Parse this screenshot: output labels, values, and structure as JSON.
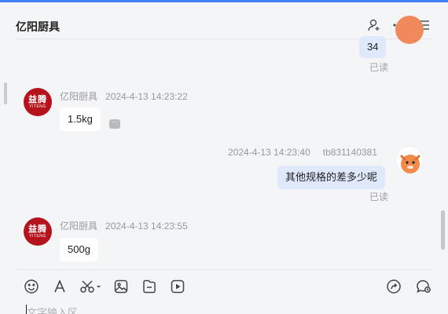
{
  "window": {
    "accent": "#3f7ff3"
  },
  "header": {
    "title": "亿阳厨具",
    "icons": [
      "add-contact-icon",
      "more-icon",
      "list-menu-icon"
    ]
  },
  "messages": [
    {
      "direction": "out",
      "text": "34",
      "status": "已读"
    },
    {
      "direction": "in",
      "sender": "亿阳厨具",
      "time": "2024-4-13 14:23:22",
      "text": "1.5kg",
      "chip": "···"
    },
    {
      "direction": "out",
      "sender": "tb831140381",
      "time": "2024-4-13 14:23:40",
      "text": "其他规格的差多少呢",
      "status": "已读"
    },
    {
      "direction": "in",
      "sender": "亿阳厨具",
      "time": "2024-4-13 14:23:55",
      "text": "500g"
    }
  ],
  "shop_avatar": {
    "cn": "益腾",
    "en": "YITENG",
    "color": "#b5121b"
  },
  "toolbar": {
    "icons": [
      "emoji-icon",
      "font-icon",
      "screenshot-icon",
      "image-icon",
      "file-icon",
      "video-icon"
    ],
    "right_icons": [
      "share-icon",
      "quick-reply-icon"
    ]
  },
  "input": {
    "placeholder": "文字输入区"
  }
}
